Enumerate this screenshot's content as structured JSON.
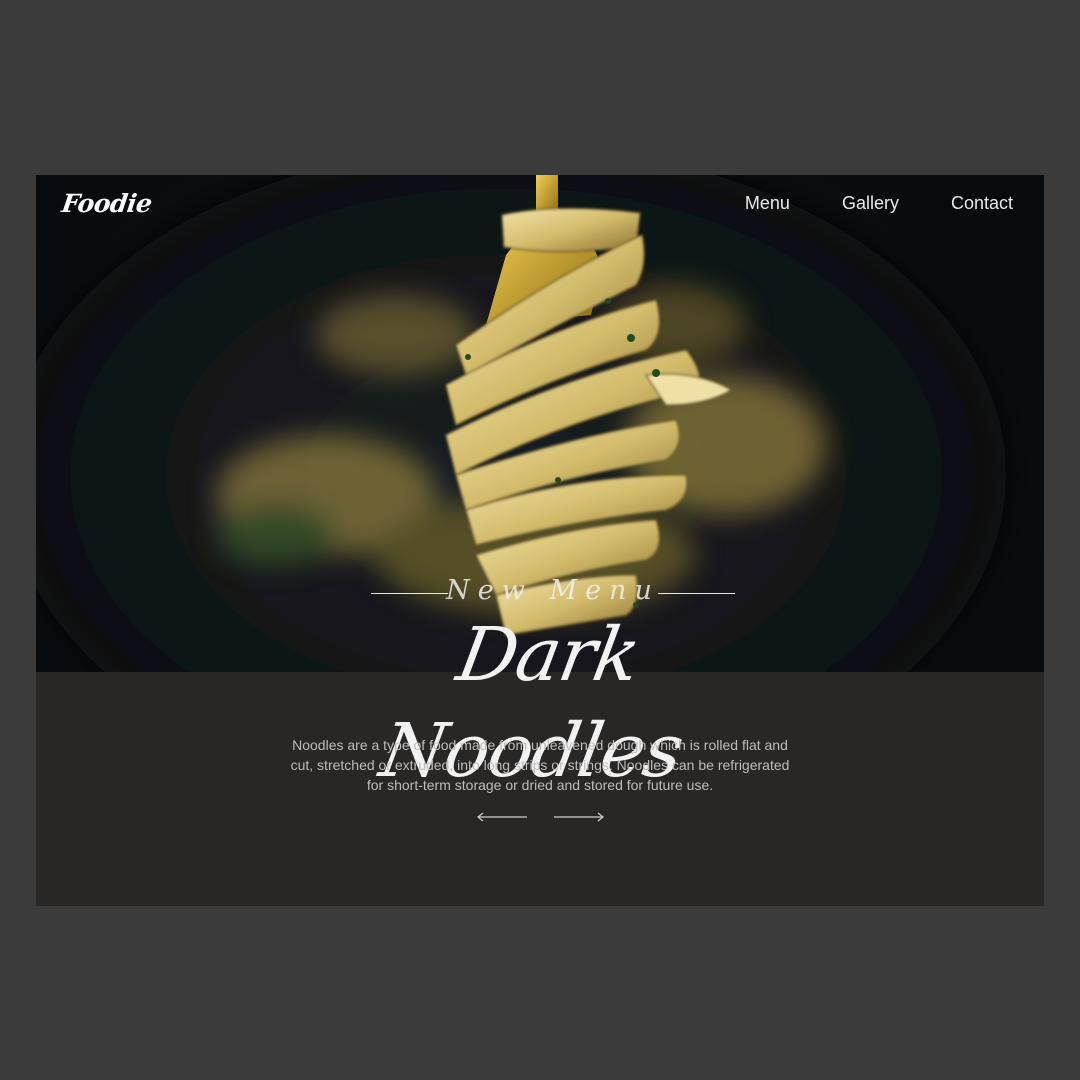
{
  "brand": {
    "logo_text": "Foodie"
  },
  "nav": {
    "items": [
      {
        "label": "Menu"
      },
      {
        "label": "Gallery"
      },
      {
        "label": "Contact"
      }
    ]
  },
  "hero": {
    "image": "fork-with-twirled-noodles-photo",
    "eyebrow": "New Menu",
    "title": "Dark Noodles",
    "description": "Noodles are a type of food made from unleavened dough which is rolled flat and cut, stretched or extruded, into long strips or strings. Noodles can be refrigerated for short-term storage or dried and stored for future use."
  },
  "controls": {
    "prev_icon": "arrow-left-icon",
    "next_icon": "arrow-right-icon"
  },
  "colors": {
    "page_bg": "#3b3b3b",
    "card_bg": "#292725",
    "hero_bg": "#0d1114",
    "noodle": "#d8c27a",
    "text": "#f2f2f2",
    "muted_text": "#bdbdbd"
  }
}
